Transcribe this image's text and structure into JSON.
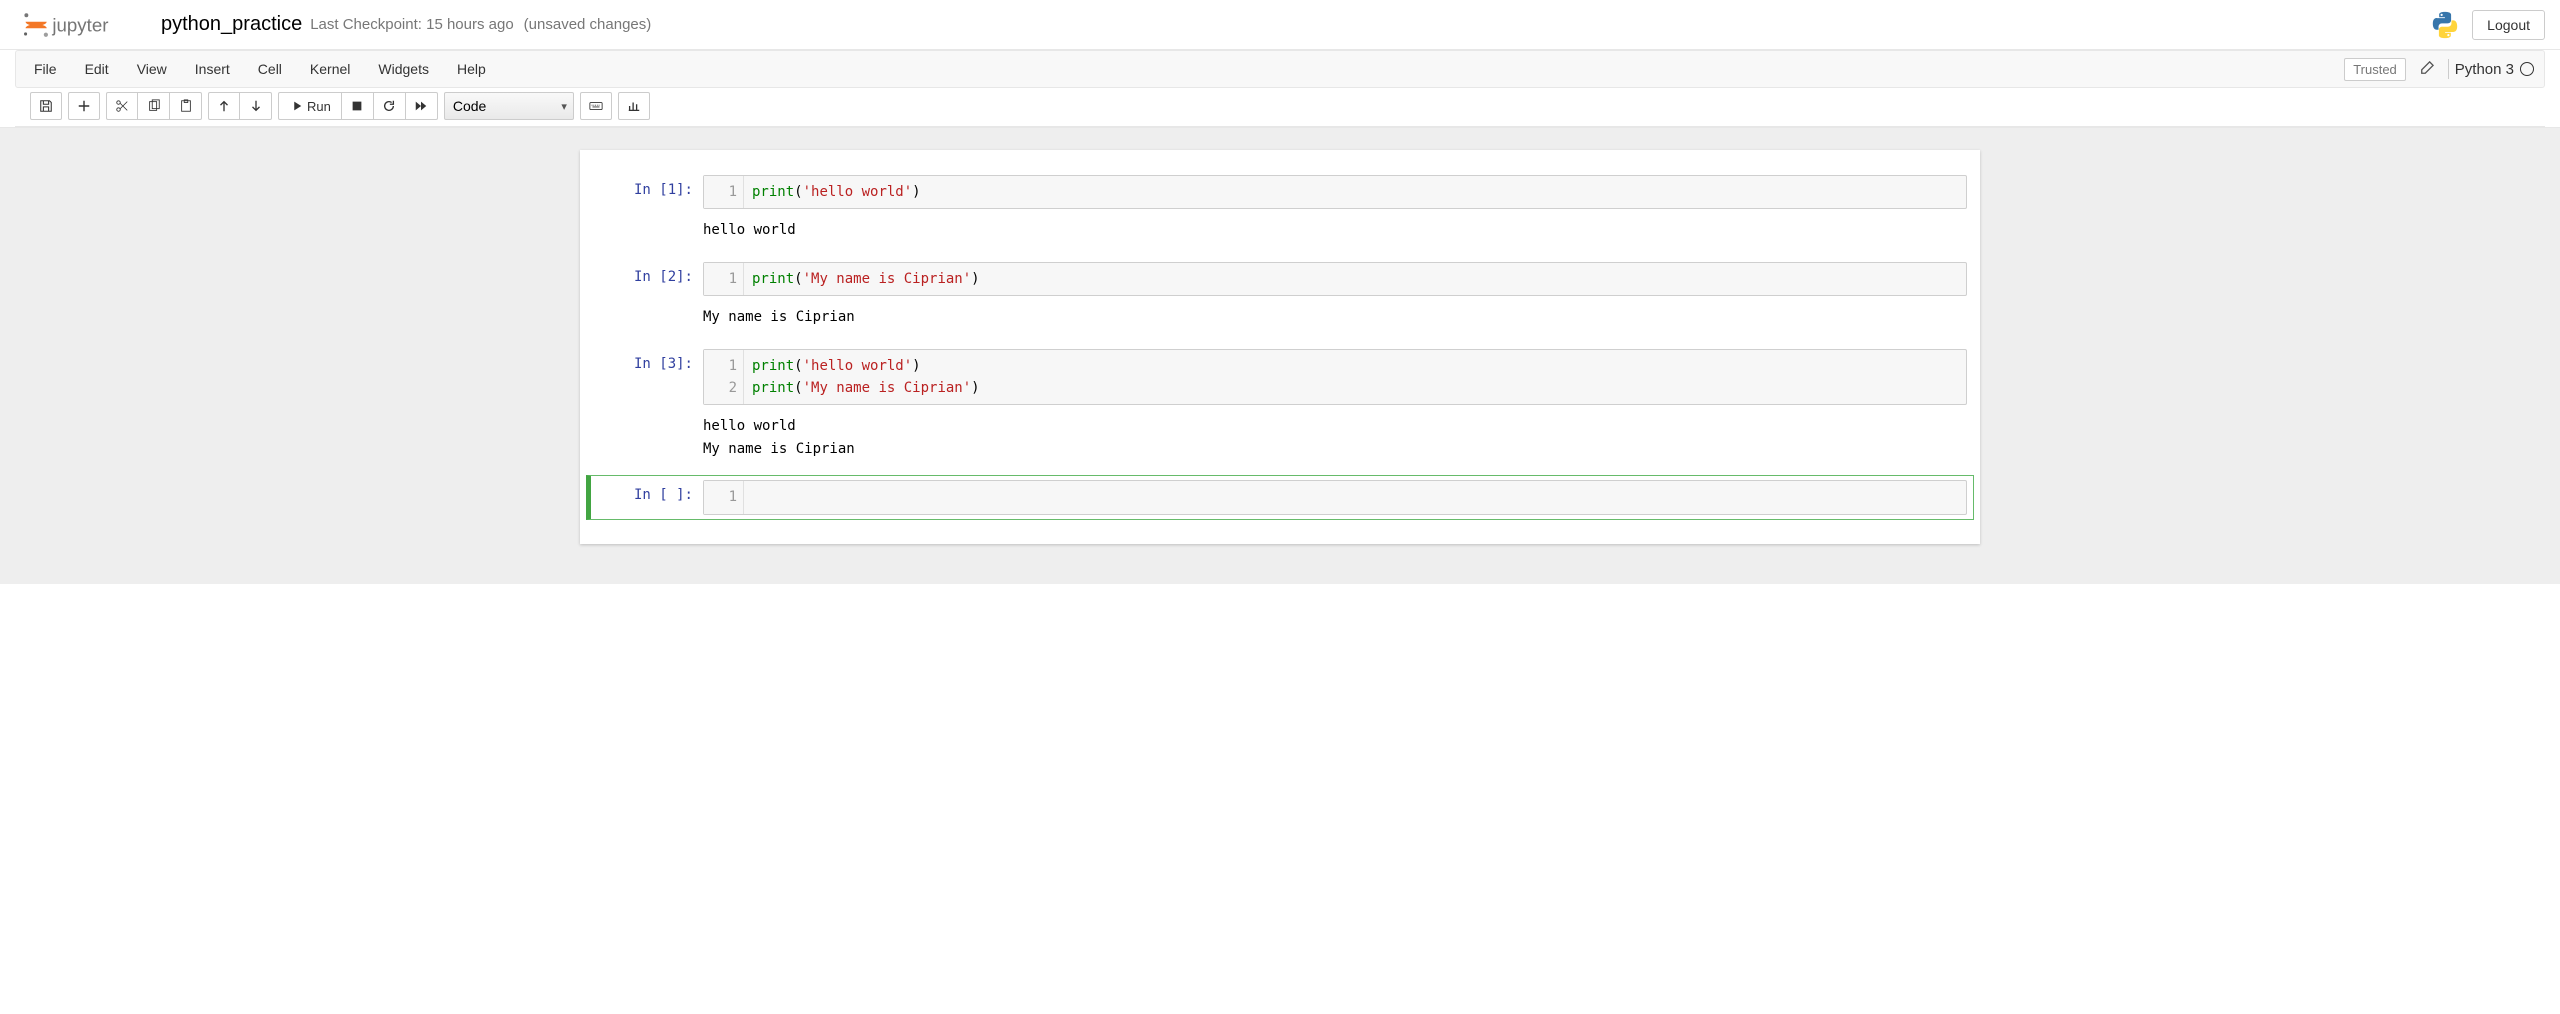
{
  "header": {
    "brand": "jupyter",
    "notebook_name": "python_practice",
    "checkpoint": "Last Checkpoint: 15 hours ago",
    "unsaved": "(unsaved changes)",
    "logout": "Logout"
  },
  "menu": {
    "file": "File",
    "edit": "Edit",
    "view": "View",
    "insert": "Insert",
    "cell": "Cell",
    "kernel": "Kernel",
    "widgets": "Widgets",
    "help": "Help",
    "trusted": "Trusted",
    "kernel_name": "Python 3"
  },
  "toolbar": {
    "run_label": "Run",
    "cell_type": "Code"
  },
  "cells": [
    {
      "prompt": "In [1]:",
      "lines": [
        {
          "n": "1",
          "fn": "print",
          "open": "(",
          "str": "'hello world'",
          "close": ")"
        }
      ],
      "output": "hello world"
    },
    {
      "prompt": "In [2]:",
      "lines": [
        {
          "n": "1",
          "fn": "print",
          "open": "(",
          "str": "'My name is Ciprian'",
          "close": ")"
        }
      ],
      "output": "My name is Ciprian"
    },
    {
      "prompt": "In [3]:",
      "lines": [
        {
          "n": "1",
          "fn": "print",
          "open": "(",
          "str": "'hello world'",
          "close": ")"
        },
        {
          "n": "2",
          "fn": "print",
          "open": "(",
          "str": "'My name is Ciprian'",
          "close": ")"
        }
      ],
      "output": "hello world\nMy name is Ciprian"
    },
    {
      "prompt": "In [ ]:",
      "lines": [
        {
          "n": "1",
          "fn": "",
          "open": "",
          "str": "",
          "close": ""
        }
      ],
      "output": null,
      "selected": true
    }
  ]
}
